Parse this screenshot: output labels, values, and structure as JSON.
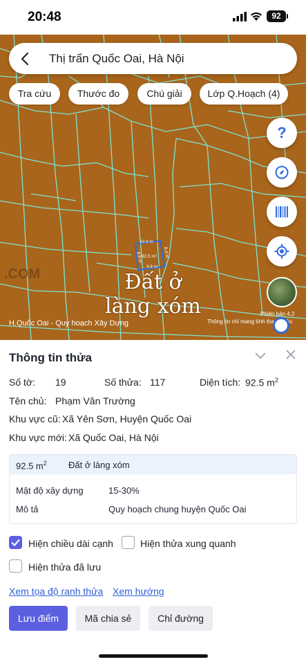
{
  "status_bar": {
    "time": "20:48",
    "battery": "92"
  },
  "search": {
    "title": "Thị trấn Quốc Oai, Hà Nội"
  },
  "chips": [
    "Tra cứu",
    "Thước đo",
    "Chú giải",
    "Lớp Q.Hoạch (4)"
  ],
  "fab_icons": [
    "help-icon",
    "compass-icon",
    "barcode-icon",
    "locate-icon"
  ],
  "map": {
    "zone_label_line1": "Đất ở",
    "zone_label_line2": "làng xóm",
    "parcel_area": "92.5 m²",
    "edge_top": "10.9 m",
    "edge_right": "8.4 m",
    "edge_left": "8.8 m",
    "edge_bottom": "9.8 m",
    "watermark": ".COM",
    "footer": "H.Quốc Oai - Quy hoạch Xây Dựng",
    "note": "Thông tin chỉ mang tính tham khảo",
    "basemap_label": "Phiên bản 4.2"
  },
  "parcel": {
    "header": "Thông tin thửa",
    "so_to_label": "Số tờ:",
    "so_to_value": "19",
    "so_thua_label": "Số thửa:",
    "so_thua_value": "117",
    "dien_tich_label": "Diện tích:",
    "dien_tich_value": "92.5 m",
    "dien_tich_unit": "2",
    "chu_label": "Tên chủ:",
    "chu_value": "Phạm Văn Trường",
    "kv_cu_label": "Khu vực cũ:",
    "kv_cu_value": "Xã Yên Sơn, Huyện Quốc Oai",
    "kv_moi_label": "Khu vực mới:",
    "kv_moi_value": "Xã Quốc Oai, Hà Nội"
  },
  "zone": {
    "area": "92.5 m",
    "area_unit": "2",
    "name": "Đất ở làng xóm",
    "density_label": "Mật độ xây dựng",
    "density_value": "15-30%",
    "desc_label": "Mô tả",
    "desc_value": "Quy hoạch chung huyện Quốc Oai"
  },
  "options": {
    "show_edges": {
      "label": "Hiện chiều dài cạnh",
      "checked": true
    },
    "show_neighbors": {
      "label": "Hiện thửa xung quanh",
      "checked": false
    },
    "show_saved": {
      "label": "Hiện thửa đã lưu",
      "checked": false
    }
  },
  "links": {
    "coords": "Xem tọa độ ranh thửa",
    "direction": "Xem hướng"
  },
  "actions": {
    "save": "Lưu điểm",
    "share": "Mã chia sẻ",
    "route": "Chỉ đường"
  },
  "colors": {
    "map_fill": "#a8651b",
    "parcel_lines": "#7fe3d4",
    "accent": "#5b5fe0",
    "link": "#2f5fd6"
  }
}
